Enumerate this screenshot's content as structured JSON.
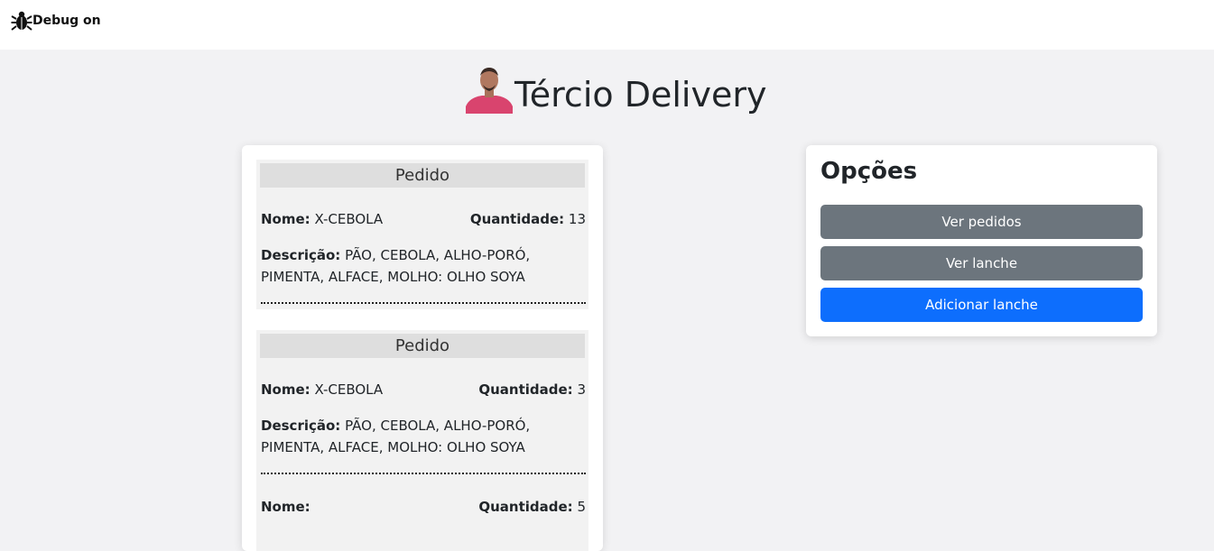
{
  "debug": {
    "label": "Debug on",
    "icon": "bug-icon"
  },
  "brand": {
    "title": "Tércio Delivery",
    "avatar": "avatar"
  },
  "orders": [
    {
      "header": "Pedido",
      "name_label": "Nome:",
      "name_value": "X-CEBOLA",
      "qty_label": "Quantidade:",
      "qty_value": "13",
      "desc_label": "Descrição:",
      "desc_value": "PÃO, CEBOLA, ALHO-PORÓ, PIMENTA, ALFACE, MOLHO: OLHO SOYA"
    },
    {
      "header": "Pedido",
      "name_label": "Nome:",
      "name_value": "X-CEBOLA",
      "qty_label": "Quantidade:",
      "qty_value": "3",
      "desc_label": "Descrição:",
      "desc_value": "PÃO, CEBOLA, ALHO-PORÓ, PIMENTA, ALFACE, MOLHO: OLHO SOYA",
      "extra": {
        "name_label": "Nome:",
        "name_value": "",
        "qty_label": "Quantidade:",
        "qty_value": "5"
      }
    }
  ],
  "options": {
    "title": "Opções",
    "buttons": [
      "Ver pedidos",
      "Ver lanche",
      "Adicionar lanche"
    ]
  },
  "colors": {
    "page_bg": "#f2f2f4",
    "secondary": "#6c757d",
    "primary": "#0d6efd"
  }
}
